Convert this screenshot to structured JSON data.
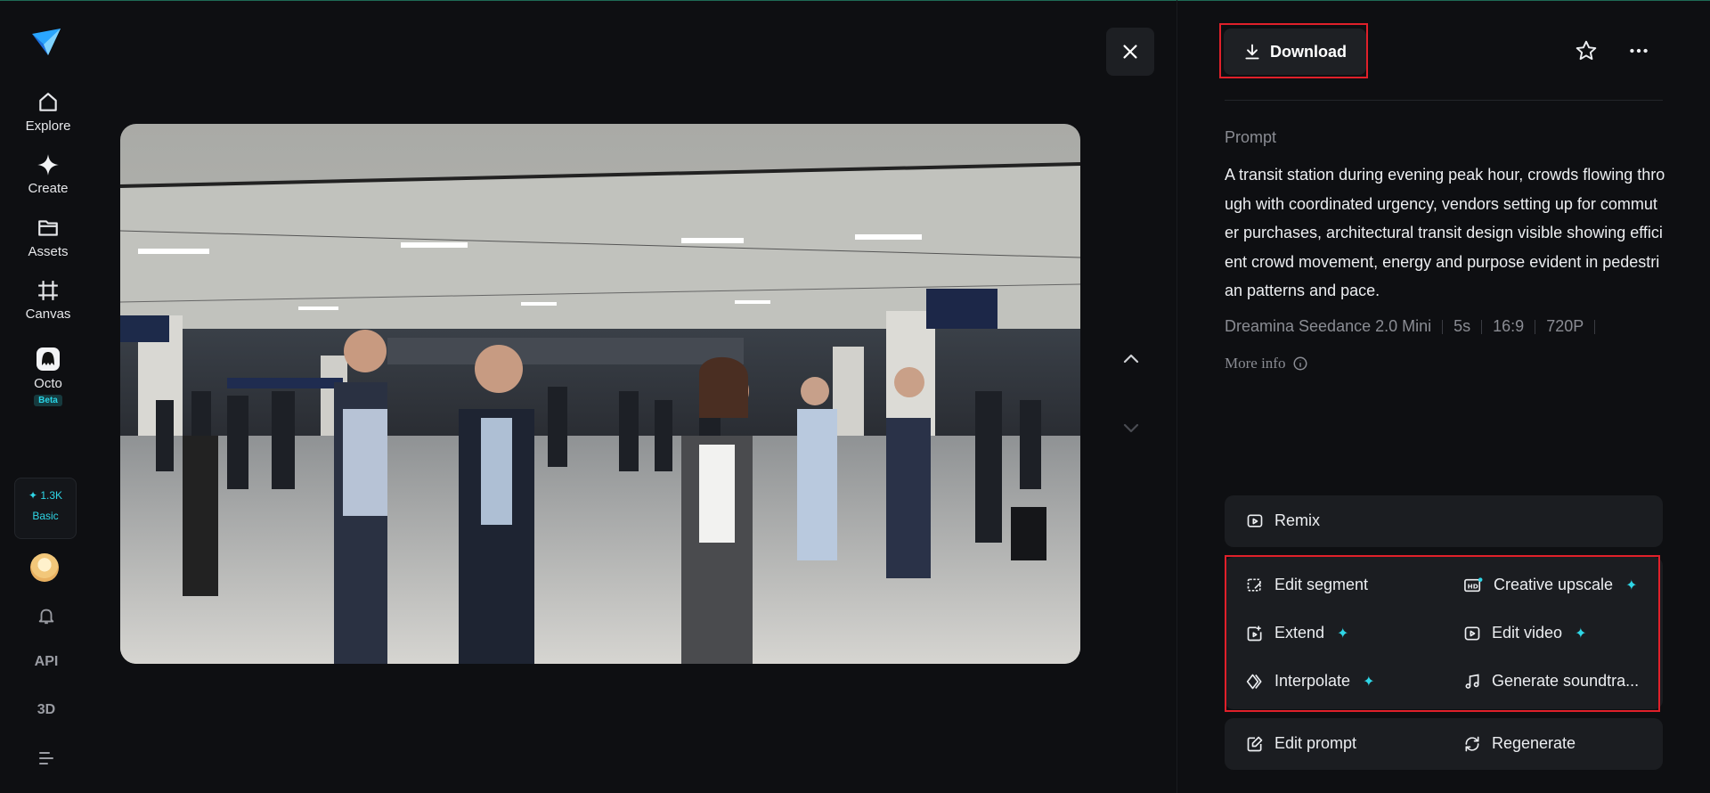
{
  "sidebar": {
    "logo": "paper-plane-logo",
    "items": [
      {
        "label": "Explore",
        "icon": "home-icon"
      },
      {
        "label": "Create",
        "icon": "sparkle-icon"
      },
      {
        "label": "Assets",
        "icon": "folder-icon"
      },
      {
        "label": "Canvas",
        "icon": "canvas-icon"
      },
      {
        "label": "Octo",
        "icon": "octo-icon",
        "badge": "Beta"
      }
    ],
    "credits": {
      "amount": "✦ 1.3K",
      "plan": "Basic"
    },
    "api_label": "API",
    "threed_label": "3D"
  },
  "viewer": {
    "image_alt": "Crowded transit station concourse during evening peak hour",
    "close_icon": "close-icon",
    "prev_icon": "chevron-up-icon",
    "next_icon": "chevron-down-icon"
  },
  "panel": {
    "download_label": "Download",
    "prompt_label": "Prompt",
    "prompt_text": "A transit station during evening peak hour, crowds flowing through with coordinated urgency, vendors setting up for commuter purchases, architectural transit design visible showing efficient crowd movement, energy and purpose evident in pedestrian patterns and pace.",
    "meta": [
      "Dreamina Seedance 2.0 Mini",
      "5s",
      "16:9",
      "720P"
    ],
    "more_info": "More info",
    "remix": "Remix",
    "actions": {
      "edit_segment": "Edit segment",
      "creative_upscale": "Creative upscale",
      "extend": "Extend",
      "edit_video": "Edit video",
      "interpolate": "Interpolate",
      "generate_soundtrack": "Generate soundtra...",
      "edit_prompt": "Edit prompt",
      "regenerate": "Regenerate"
    }
  },
  "colors": {
    "background": "#0e0f12",
    "card": "#1b1d21",
    "accent": "#2fd6e6",
    "highlight": "#e0202a"
  }
}
